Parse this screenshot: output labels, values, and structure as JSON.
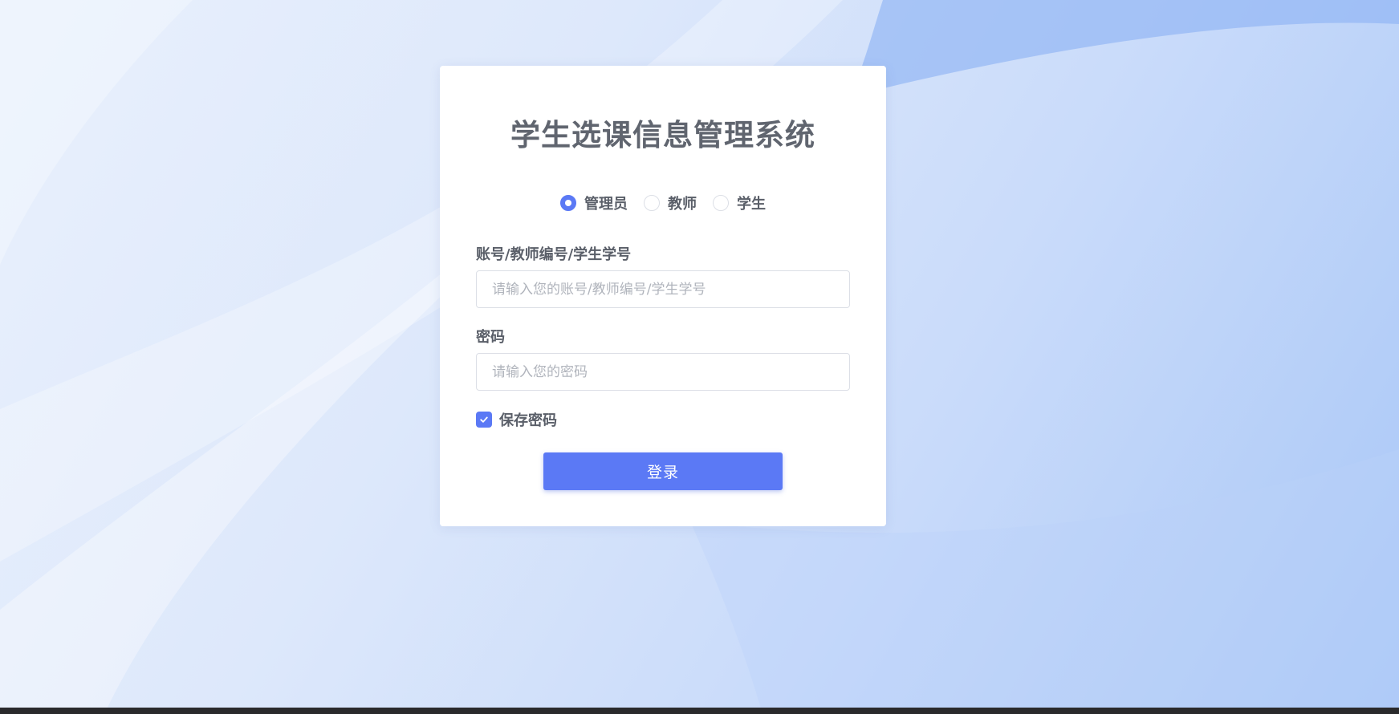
{
  "app": {
    "title": "学生选课信息管理系统"
  },
  "roles": [
    {
      "label": "管理员",
      "selected": true
    },
    {
      "label": "教师",
      "selected": false
    },
    {
      "label": "学生",
      "selected": false
    }
  ],
  "form": {
    "account_label": "账号/教师编号/学生学号",
    "account_placeholder": "请输入您的账号/教师编号/学生学号",
    "account_value": "",
    "password_label": "密码",
    "password_placeholder": "请输入您的密码",
    "password_value": "",
    "remember_label": "保存密码",
    "remember_checked": true,
    "submit_label": "登录"
  },
  "colors": {
    "accent": "#5b79f5",
    "title_text": "#60656f",
    "label_text": "#5a5f69",
    "placeholder_text": "#b0b4bc",
    "card_bg": "#ffffff"
  }
}
